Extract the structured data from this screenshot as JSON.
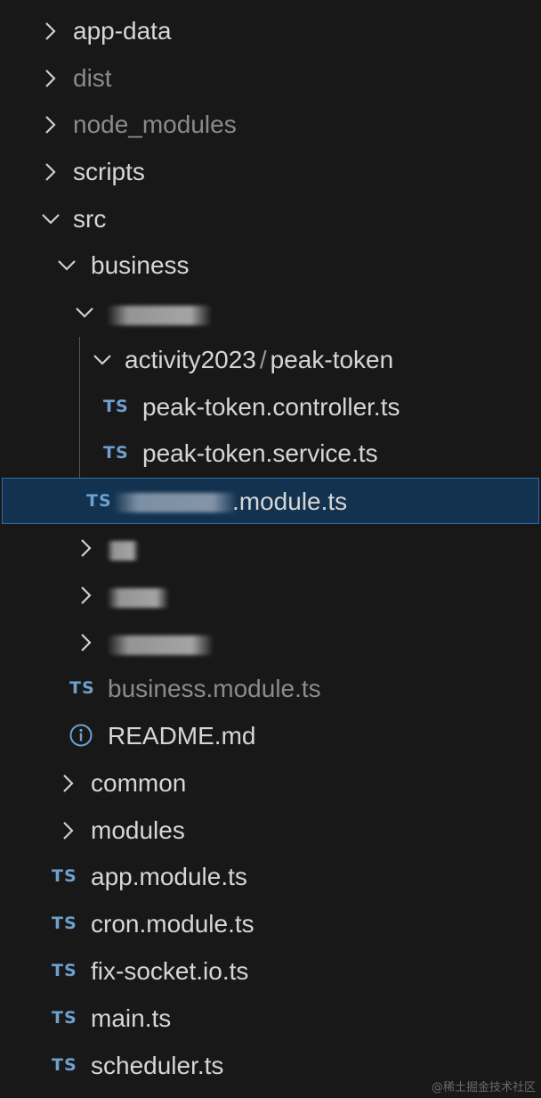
{
  "explorer": {
    "items": [
      {
        "label": "app-data",
        "type": "folder",
        "expanded": false
      },
      {
        "label": "dist",
        "type": "folder",
        "expanded": false,
        "dimmed": true
      },
      {
        "label": "node_modules",
        "type": "folder",
        "expanded": false,
        "dimmed": true
      },
      {
        "label": "scripts",
        "type": "folder",
        "expanded": false
      },
      {
        "label": "src",
        "type": "folder",
        "expanded": true
      },
      {
        "label": "business",
        "type": "folder",
        "expanded": true
      },
      {
        "label": "baofang",
        "type": "folder",
        "expanded": true,
        "obscured": true
      },
      {
        "label": "activity2023",
        "label_suffix": "peak-token",
        "separator": "/",
        "type": "folder",
        "expanded": true
      },
      {
        "label": "peak-token.controller.ts",
        "type": "ts-file",
        "icon_text": "TS"
      },
      {
        "label": "peak-token.service.ts",
        "type": "ts-file",
        "icon_text": "TS"
      },
      {
        "label": "baofang.module.ts",
        "visible_label": ".module.ts",
        "type": "ts-file",
        "icon_text": "TS",
        "selected": true,
        "obscured": true
      },
      {
        "label": "ka",
        "type": "folder",
        "expanded": false,
        "obscured": true
      },
      {
        "label": "",
        "type": "folder",
        "expanded": false,
        "obscured": true
      },
      {
        "label": "member",
        "type": "folder",
        "expanded": false,
        "obscured": true
      },
      {
        "label": "business.module.ts",
        "type": "ts-file",
        "icon_text": "TS",
        "dimmed": true
      },
      {
        "label": "README.md",
        "type": "info-file",
        "icon": "info-icon"
      },
      {
        "label": "common",
        "type": "folder",
        "expanded": false
      },
      {
        "label": "modules",
        "type": "folder",
        "expanded": false
      },
      {
        "label": "app.module.ts",
        "type": "ts-file",
        "icon_text": "TS"
      },
      {
        "label": "cron.module.ts",
        "type": "ts-file",
        "icon_text": "TS"
      },
      {
        "label": "fix-socket.io.ts",
        "type": "ts-file",
        "icon_text": "TS"
      },
      {
        "label": "main.ts",
        "type": "ts-file",
        "icon_text": "TS"
      },
      {
        "label": "scheduler.ts",
        "type": "ts-file",
        "icon_text": "TS"
      }
    ]
  },
  "watermark": "@稀土掘金技术社区",
  "colors": {
    "background": "#181818",
    "selection_bg": "#12324f",
    "selection_border": "#2f6fa8",
    "ts_icon": "#6ea0cf",
    "text": "#d6d6d6",
    "dimmed_text": "#8b8b8b"
  }
}
